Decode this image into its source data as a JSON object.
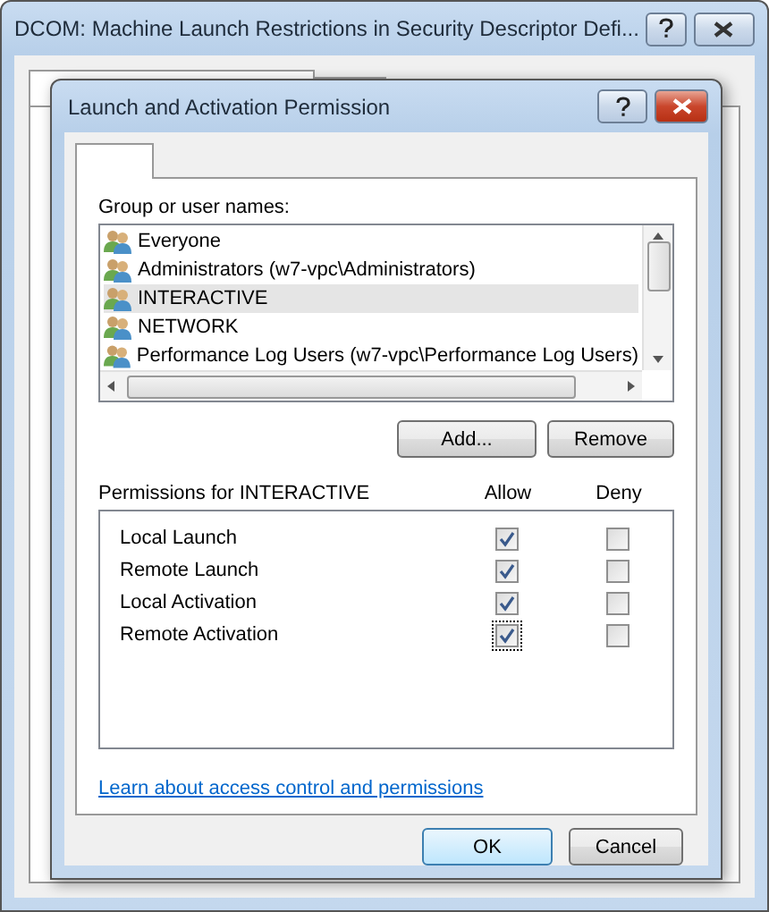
{
  "outer_window": {
    "title": "DCOM: Machine Launch Restrictions in Security Descriptor Defi..."
  },
  "dialog": {
    "title": "Launch and Activation Permission",
    "group_label": "Group or user names:",
    "users": [
      {
        "name": "Everyone",
        "selected": false
      },
      {
        "name": "Administrators (w7-vpc\\Administrators)",
        "selected": false
      },
      {
        "name": "INTERACTIVE",
        "selected": true
      },
      {
        "name": "NETWORK",
        "selected": false
      },
      {
        "name": "Performance Log Users (w7-vpc\\Performance Log Users)",
        "selected": false
      }
    ],
    "list_buttons": [
      "Add...",
      "Remove"
    ],
    "permissions_label": "Permissions for INTERACTIVE",
    "allow_header": "Allow",
    "deny_header": "Deny",
    "permissions": [
      {
        "name": "Local Launch",
        "allow": true,
        "deny": false,
        "focused": false
      },
      {
        "name": "Remote Launch",
        "allow": true,
        "deny": false,
        "focused": false
      },
      {
        "name": "Local Activation",
        "allow": true,
        "deny": false,
        "focused": false
      },
      {
        "name": "Remote Activation",
        "allow": true,
        "deny": false,
        "focused": true
      }
    ],
    "link": "Learn about access control and permissions",
    "buttons": [
      {
        "label": "OK",
        "default": true
      },
      {
        "label": "Cancel",
        "default": false
      }
    ]
  }
}
